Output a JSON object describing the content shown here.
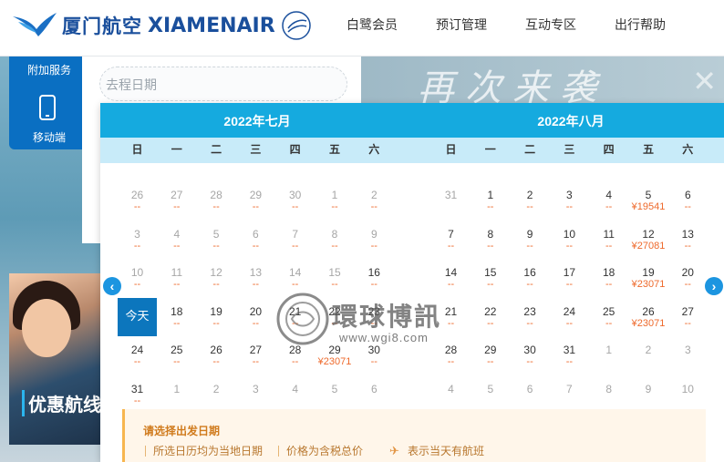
{
  "header": {
    "logo_cn": "厦门航空",
    "logo_en": "XIAMENAIR",
    "nav": [
      {
        "label": "白鹭会员"
      },
      {
        "label": "预订管理"
      },
      {
        "label": "互动专区"
      },
      {
        "label": "出行帮助"
      }
    ]
  },
  "hero": {
    "slogan": "再次来袭"
  },
  "side_menu": {
    "items": [
      {
        "label": "附加服务"
      },
      {
        "label": "移动端",
        "icon": "mobile-phone-icon"
      }
    ]
  },
  "search": {
    "date_placeholder": "去程日期"
  },
  "promo": {
    "text": "优惠航线"
  },
  "calendar": {
    "weekdays": [
      "日",
      "一",
      "二",
      "三",
      "四",
      "五",
      "六"
    ],
    "months": [
      {
        "title": "2022年七月",
        "weeks": [
          [
            {
              "d": "26",
              "m": true,
              "p": "--"
            },
            {
              "d": "27",
              "m": true,
              "p": "--"
            },
            {
              "d": "28",
              "m": true,
              "p": "--"
            },
            {
              "d": "29",
              "m": true,
              "p": "--"
            },
            {
              "d": "30",
              "m": true,
              "p": "--"
            },
            {
              "d": "1",
              "m": true,
              "p": "--"
            },
            {
              "d": "2",
              "m": true,
              "p": "--"
            }
          ],
          [
            {
              "d": "3",
              "m": true,
              "p": "--"
            },
            {
              "d": "4",
              "m": true,
              "p": "--"
            },
            {
              "d": "5",
              "m": true,
              "p": "--"
            },
            {
              "d": "6",
              "m": true,
              "p": "--"
            },
            {
              "d": "7",
              "m": true,
              "p": "--"
            },
            {
              "d": "8",
              "m": true,
              "p": "--"
            },
            {
              "d": "9",
              "m": true,
              "p": "--"
            }
          ],
          [
            {
              "d": "10",
              "m": true,
              "p": "--"
            },
            {
              "d": "11",
              "m": true,
              "p": "--"
            },
            {
              "d": "12",
              "m": true,
              "p": "--"
            },
            {
              "d": "13",
              "m": true,
              "p": "--"
            },
            {
              "d": "14",
              "m": true,
              "p": "--"
            },
            {
              "d": "15",
              "m": true,
              "p": "--"
            },
            {
              "d": "16",
              "p": "--"
            }
          ],
          [
            {
              "d": "今天",
              "today": true
            },
            {
              "d": "18",
              "p": "--"
            },
            {
              "d": "19",
              "p": "--"
            },
            {
              "d": "20",
              "p": "--"
            },
            {
              "d": "21",
              "p": "--"
            },
            {
              "d": "22",
              "p": "--"
            },
            {
              "d": "23",
              "p": "--"
            }
          ],
          [
            {
              "d": "24",
              "p": "--"
            },
            {
              "d": "25",
              "p": "--"
            },
            {
              "d": "26",
              "p": "--"
            },
            {
              "d": "27",
              "p": "--"
            },
            {
              "d": "28",
              "p": "--"
            },
            {
              "d": "29",
              "p": "¥23071"
            },
            {
              "d": "30",
              "p": "--"
            }
          ],
          [
            {
              "d": "31",
              "p": "--"
            },
            {
              "d": "1",
              "m": true,
              "p": ""
            },
            {
              "d": "2",
              "m": true,
              "p": ""
            },
            {
              "d": "3",
              "m": true,
              "p": ""
            },
            {
              "d": "4",
              "m": true,
              "p": ""
            },
            {
              "d": "5",
              "m": true,
              "p": ""
            },
            {
              "d": "6",
              "m": true,
              "p": ""
            }
          ]
        ]
      },
      {
        "title": "2022年八月",
        "weeks": [
          [
            {
              "d": "31",
              "m": true,
              "p": ""
            },
            {
              "d": "1",
              "p": "--"
            },
            {
              "d": "2",
              "p": "--"
            },
            {
              "d": "3",
              "p": "--"
            },
            {
              "d": "4",
              "p": "--"
            },
            {
              "d": "5",
              "p": "¥19541"
            },
            {
              "d": "6",
              "p": "--"
            }
          ],
          [
            {
              "d": "7",
              "p": "--"
            },
            {
              "d": "8",
              "p": "--"
            },
            {
              "d": "9",
              "p": "--"
            },
            {
              "d": "10",
              "p": "--"
            },
            {
              "d": "11",
              "p": "--"
            },
            {
              "d": "12",
              "p": "¥27081"
            },
            {
              "d": "13",
              "p": "--"
            }
          ],
          [
            {
              "d": "14",
              "p": "--"
            },
            {
              "d": "15",
              "p": "--"
            },
            {
              "d": "16",
              "p": "--"
            },
            {
              "d": "17",
              "p": "--"
            },
            {
              "d": "18",
              "p": "--"
            },
            {
              "d": "19",
              "p": "¥23071"
            },
            {
              "d": "20",
              "p": "--"
            }
          ],
          [
            {
              "d": "21",
              "p": "--"
            },
            {
              "d": "22",
              "p": "--"
            },
            {
              "d": "23",
              "p": "--"
            },
            {
              "d": "24",
              "p": "--"
            },
            {
              "d": "25",
              "p": "--"
            },
            {
              "d": "26",
              "p": "¥23071"
            },
            {
              "d": "27",
              "p": "--"
            }
          ],
          [
            {
              "d": "28",
              "p": "--"
            },
            {
              "d": "29",
              "p": "--"
            },
            {
              "d": "30",
              "p": "--"
            },
            {
              "d": "31",
              "p": "--"
            },
            {
              "d": "1",
              "m": true,
              "p": ""
            },
            {
              "d": "2",
              "m": true,
              "p": ""
            },
            {
              "d": "3",
              "m": true,
              "p": ""
            }
          ],
          [
            {
              "d": "4",
              "m": true,
              "p": ""
            },
            {
              "d": "5",
              "m": true,
              "p": ""
            },
            {
              "d": "6",
              "m": true,
              "p": ""
            },
            {
              "d": "7",
              "m": true,
              "p": ""
            },
            {
              "d": "8",
              "m": true,
              "p": ""
            },
            {
              "d": "9",
              "m": true,
              "p": ""
            },
            {
              "d": "10",
              "m": true,
              "p": ""
            }
          ]
        ]
      }
    ],
    "notice": {
      "title": "请选择出发日期",
      "items": [
        "所选日历均为当地日期",
        "价格为含税总价",
        "表示当天有航班"
      ]
    }
  },
  "watermark": {
    "title": "環球博訊",
    "url": "www.wgi8.com"
  },
  "colors": {
    "brand": "#1a4f9c",
    "calendar_header": "#15aadf",
    "today": "#0c76bd",
    "price": "#ee6a2c"
  }
}
